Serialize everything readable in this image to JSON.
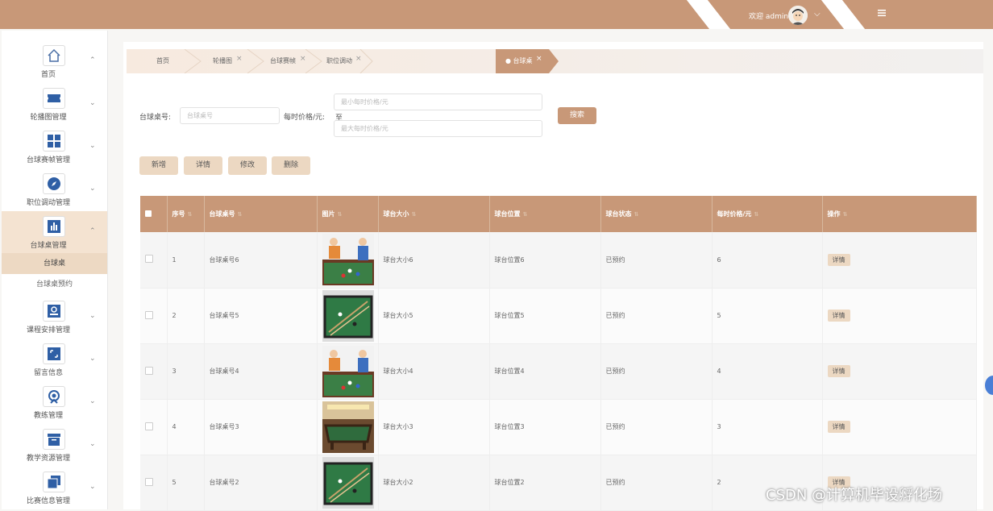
{
  "header": {
    "welcome": "欢迎 admin",
    "chevron": "⌵"
  },
  "sidebar": {
    "groups": [
      {
        "label": "首页",
        "icon": "home-icon"
      },
      {
        "label": "轮播图管理",
        "icon": "carousel-icon"
      },
      {
        "label": "台球赛帧管理",
        "icon": "grid-icon"
      },
      {
        "label": "职位调动管理",
        "icon": "compass-icon"
      },
      {
        "label": "台球桌管理",
        "icon": "chart-icon"
      },
      {
        "label": "课程安排管理",
        "icon": "badge-icon"
      },
      {
        "label": "留言信息",
        "icon": "message-icon"
      },
      {
        "label": "教练管理",
        "icon": "coach-icon"
      },
      {
        "label": "教学资源管理",
        "icon": "archive-icon"
      },
      {
        "label": "比赛信息管理",
        "icon": "copy-icon"
      }
    ],
    "sub_items": [
      "台球桌",
      "台球桌预约"
    ]
  },
  "breadcrumbs": {
    "items": [
      "首页",
      "轮播图",
      "台球赛帧",
      "职位调动"
    ],
    "active": "● 台球桌",
    "close": "×"
  },
  "filters": {
    "table_no_label": "台球桌号:",
    "table_no_placeholder": "台球桌号",
    "price_label": "每时价格/元:",
    "price_min_placeholder": "最小每时价格/元",
    "range_sep": "至",
    "price_max_placeholder": "最大每时价格/元",
    "search_label": "搜索"
  },
  "actions": {
    "add": "新增",
    "detail": "详情",
    "edit": "修改",
    "delete": "删除"
  },
  "table": {
    "columns": [
      "序号",
      "台球桌号",
      "图片",
      "球台大小",
      "球台位置",
      "球台状态",
      "每时价格/元",
      "操作"
    ],
    "rows": [
      {
        "no": "1",
        "table_no": "台球桌号6",
        "image": "cartoon-players",
        "size": "球台大小6",
        "location": "球台位置6",
        "status": "已预约",
        "price": "6",
        "action": "详情"
      },
      {
        "no": "2",
        "table_no": "台球桌号5",
        "image": "green-table-cues",
        "size": "球台大小5",
        "location": "球台位置5",
        "status": "已预约",
        "price": "5",
        "action": "详情"
      },
      {
        "no": "3",
        "table_no": "台球桌号4",
        "image": "cartoon-players",
        "size": "球台大小4",
        "location": "球台位置4",
        "status": "已预约",
        "price": "4",
        "action": "详情"
      },
      {
        "no": "4",
        "table_no": "台球桌号3",
        "image": "room-table",
        "size": "球台大小3",
        "location": "球台位置3",
        "status": "已预约",
        "price": "3",
        "action": "详情"
      },
      {
        "no": "5",
        "table_no": "台球桌号2",
        "image": "green-table-cues",
        "size": "球台大小2",
        "location": "球台位置2",
        "status": "已预约",
        "price": "2",
        "action": "详情"
      }
    ]
  },
  "watermark": "CSDN @计算机毕设孵化场",
  "colors": {
    "accent": "#c89878",
    "light_accent": "#ecd8c2"
  }
}
